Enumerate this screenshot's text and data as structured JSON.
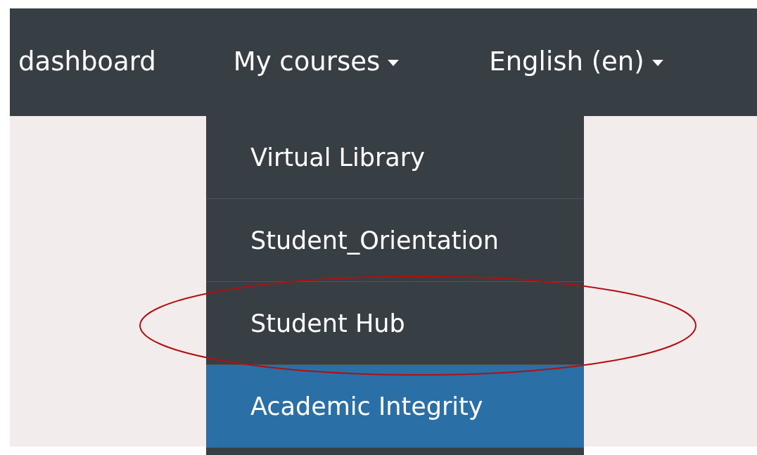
{
  "navbar": {
    "items": [
      {
        "label": "dashboard",
        "kind": "link"
      },
      {
        "label": "My courses",
        "kind": "dropdown"
      },
      {
        "label": "English (en)",
        "kind": "dropdown"
      }
    ]
  },
  "menu": {
    "items": [
      {
        "label": "Virtual Library",
        "selected": false
      },
      {
        "label": "Student_Orientation",
        "selected": false
      },
      {
        "label": "Student Hub",
        "selected": false
      },
      {
        "label": "Academic Integrity",
        "selected": true
      }
    ]
  },
  "annotation": {
    "kind": "ellipse",
    "color": "#b01010"
  }
}
